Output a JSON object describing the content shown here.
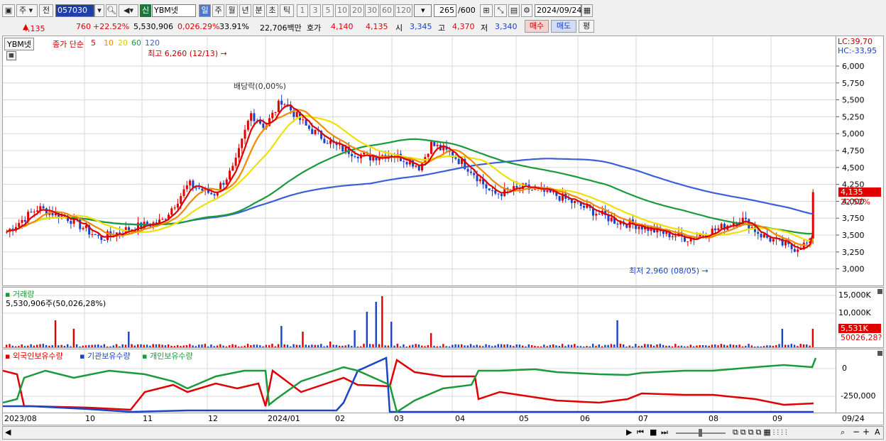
{
  "toolbar": {
    "market": "주",
    "prev": "전",
    "code": "057030",
    "name_badge": "신",
    "name": "YBM넷",
    "periods": [
      "일",
      "주",
      "월",
      "년",
      "분",
      "초",
      "틱"
    ],
    "spans": [
      "1",
      "3",
      "5",
      "10",
      "20",
      "30",
      "60",
      "120"
    ],
    "count": "265",
    "count_max": "/600",
    "date": "2024/09/24"
  },
  "quote": {
    "price": "4,135",
    "change": "760",
    "change_pct": "+22.52%",
    "volume": "5,530,906",
    "vol_ratio": "0,026.29%",
    "turnover": "33.91%",
    "amount": "22,706백만",
    "bid_label": "호가",
    "bid": "4,140",
    "ask": "4,135",
    "open_label": "시",
    "open": "3,345",
    "high_label": "고",
    "high": "4,370",
    "low_label": "저",
    "low": "3,340",
    "buy": "매수",
    "sell": "매도",
    "avg": "평"
  },
  "price_panel": {
    "name": "YBM넷",
    "legend_prefix": "종가 단순",
    "ma": [
      "5",
      "10",
      "20",
      "60",
      "120"
    ],
    "high_note": "최고 6,260 (12/13)",
    "low_note": "최저 2,960 (08/05)",
    "div_note": "배당락(0,00%)",
    "lc": "LC:39,70",
    "hc": "HC:-33,95",
    "last_price": "4,135",
    "last_pct": "22,52%",
    "y_ticks": [
      "6,000",
      "5,750",
      "5,500",
      "5,250",
      "5,000",
      "4,750",
      "4,500",
      "4,250",
      "4,000",
      "3,750",
      "3,500",
      "3,250",
      "3,000"
    ]
  },
  "volume_panel": {
    "title": "거래량",
    "summary": "5,530,906주(50,026,28%)",
    "y_ticks": [
      "15,000K",
      "10,000K"
    ],
    "last": "5,531K",
    "ma_val": "50026,28?"
  },
  "holding_panel": {
    "foreign": "외국인보유수량",
    "inst": "기관보유수량",
    "indiv": "개인보유수량",
    "y_ticks": [
      "0",
      "-250,000"
    ]
  },
  "x_labels": [
    "2023/08",
    "10",
    "11",
    "12",
    "2024/01",
    "02",
    "03",
    "04",
    "05",
    "06",
    "07",
    "08",
    "09",
    "09/24"
  ],
  "colors": {
    "up": "#e00000",
    "down": "#1a44c8",
    "ma5": "#e00000",
    "ma10": "#f08a00",
    "ma20": "#f0e000",
    "ma60": "#1a9a3a",
    "ma120": "#3a5fd8",
    "bg": "#ffffff",
    "grid": "#d8d8d8"
  }
}
